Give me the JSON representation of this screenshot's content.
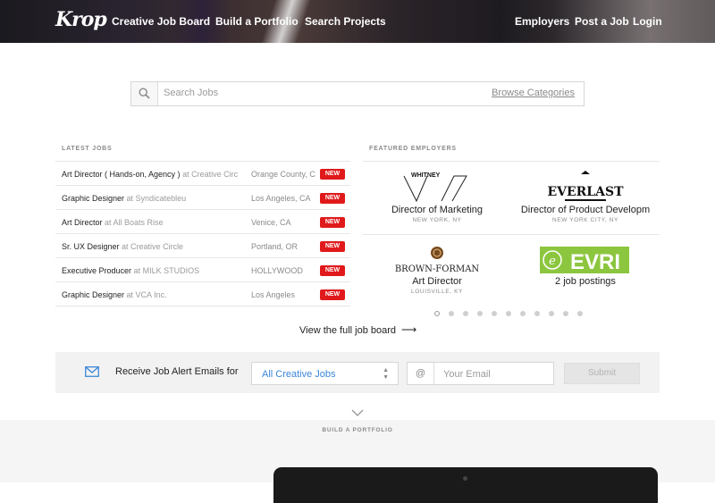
{
  "header": {
    "logo": "Krop",
    "nav_left": [
      "Creative Job Board",
      "Build a Portfolio",
      "Search Projects"
    ],
    "nav_right": [
      "Employers",
      "Post a Job",
      "Login"
    ]
  },
  "search": {
    "placeholder": "Search Jobs",
    "browse_label": "Browse Categories",
    "icon": "search-icon"
  },
  "latest_jobs": {
    "title": "LATEST JOBS",
    "badge": "NEW",
    "items": [
      {
        "title": "Art Director ( Hands-on, Agency )",
        "company": "at Creative Circ",
        "location": "Orange County, C"
      },
      {
        "title": "Graphic Designer",
        "company": "at Syndicatebleu",
        "location": "Los Angeles, CA"
      },
      {
        "title": "Art Director",
        "company": "at All Boats Rise",
        "location": "Venice, CA"
      },
      {
        "title": "Sr. UX Designer",
        "company": "at Creative Circle",
        "location": "Portland, OR"
      },
      {
        "title": "Executive Producer",
        "company": "at MILK STUDIOS",
        "location": "HOLLYWOOD"
      },
      {
        "title": "Graphic Designer",
        "company": "at VCA Inc.",
        "location": "Los Angeles"
      }
    ]
  },
  "featured_employers": {
    "title": "FEATURED EMPLOYERS",
    "items": [
      {
        "logo_text": "WHITNEY",
        "role": "Director of Marketing",
        "city": "NEW YORK, NY"
      },
      {
        "logo_text": "EVERLAST",
        "role": "Director of Product Developm",
        "city": "NEW YORK CITY, NY"
      },
      {
        "logo_text": "BROWN-FORMAN",
        "role": "Art Director",
        "city": "LOUISVILLE, KY"
      },
      {
        "logo_text": "EVRI",
        "role": "2 job postings",
        "city": ""
      }
    ],
    "pager_pages": 11,
    "pager_active": 1
  },
  "view_full_board": "View the full job board",
  "job_alerts": {
    "label": "Receive Job Alert Emails for",
    "select_value": "All Creative Jobs",
    "email_prefix": "@",
    "email_placeholder": "Your Email",
    "submit_label": "Submit"
  },
  "build_portfolio": {
    "label": "BUILD A PORTFOLIO"
  },
  "colors": {
    "badge_red": "#e0191b",
    "link_blue": "#3a86d8",
    "evri_green": "#8cc63f"
  }
}
